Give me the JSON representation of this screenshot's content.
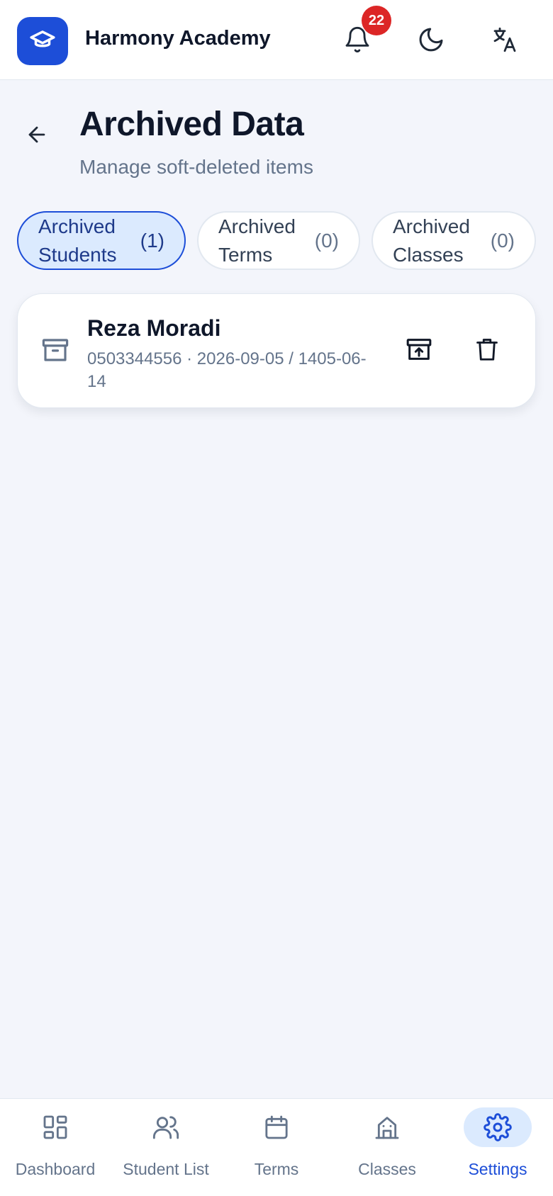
{
  "header": {
    "app_name": "Harmony Academy",
    "notification_count": "22",
    "icons": [
      "graduation-cap-icon",
      "bell-icon",
      "moon-icon",
      "translate-icon"
    ]
  },
  "page": {
    "title": "Archived Data",
    "subtitle": "Manage soft-deleted items"
  },
  "tabs": [
    {
      "label": "Archived Students",
      "count": "(1)",
      "active": true
    },
    {
      "label": "Archived Terms",
      "count": "(0)",
      "active": false
    },
    {
      "label": "Archived Classes",
      "count": "(0)",
      "active": false
    }
  ],
  "archived_items": [
    {
      "name": "Reza Moradi",
      "meta": "0503344556 · 2026-09-05 / 1405-06-14"
    }
  ],
  "nav": [
    {
      "label": "Dashboard",
      "icon": "dashboard-icon",
      "active": false
    },
    {
      "label": "Student List",
      "icon": "users-icon",
      "active": false
    },
    {
      "label": "Terms",
      "icon": "calendar-icon",
      "active": false
    },
    {
      "label": "Classes",
      "icon": "building-icon",
      "active": false
    },
    {
      "label": "Settings",
      "icon": "gear-icon",
      "active": true
    }
  ],
  "colors": {
    "primary": "#1d4ed8",
    "badge": "#dc2626",
    "background": "#f3f5fb",
    "active_tab_bg": "#dbeafe"
  }
}
